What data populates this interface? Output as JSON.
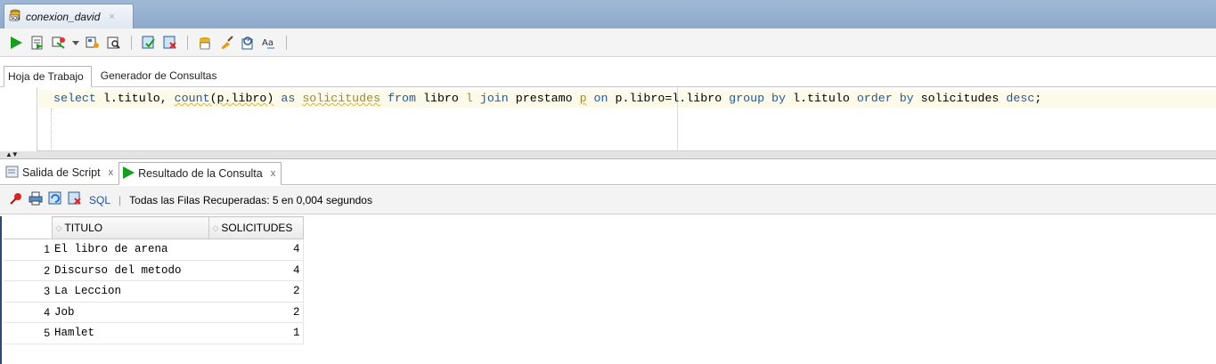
{
  "doc_tab": {
    "title": "conexion_david",
    "close": "×"
  },
  "toolbar": {
    "buttons": [
      "run-statement-icon",
      "run-script-icon",
      "autotrace-icon",
      "dropdown-chevron-icon",
      "explain-plan-icon",
      "sql-tuning-icon",
      "commit-icon",
      "rollback-icon",
      "sql-history-icon",
      "clear-icon",
      "sql-tuning-advisor-icon",
      "format-icon"
    ]
  },
  "worksheet_tabs": {
    "tab1": "Hoja de Trabajo",
    "tab2": "Generador de Consultas"
  },
  "editor": {
    "sql": [
      {
        "t": "select ",
        "c": "kw"
      },
      {
        "t": "l.titulo, ",
        "c": ""
      },
      {
        "t": "count",
        "c": "kw"
      },
      {
        "t": "(p.libro)",
        "c": ""
      },
      {
        "t": " as ",
        "c": "kw"
      },
      {
        "t": "solicitudes",
        "c": "al"
      },
      {
        "t": " from ",
        "c": "kw"
      },
      {
        "t": "libro ",
        "c": ""
      },
      {
        "t": "l",
        "c": "al"
      },
      {
        "t": " join ",
        "c": "kw"
      },
      {
        "t": "prestamo ",
        "c": ""
      },
      {
        "t": "p",
        "c": "al"
      },
      {
        "t": " on ",
        "c": "kw"
      },
      {
        "t": "p.libro=l.libro ",
        "c": ""
      },
      {
        "t": "group by ",
        "c": "kw"
      },
      {
        "t": "l.titulo ",
        "c": ""
      },
      {
        "t": "order by ",
        "c": "kw"
      },
      {
        "t": "solicitudes ",
        "c": ""
      },
      {
        "t": "desc",
        "c": "kw"
      },
      {
        "t": ";",
        "c": ""
      }
    ]
  },
  "result_tabs": {
    "script_output": "Salida de Script",
    "query_result": "Resultado de la Consulta",
    "close": "x"
  },
  "result_toolbar": {
    "sql_link": "SQL",
    "status": "Todas las Filas Recuperadas: 5 en 0,004 segundos"
  },
  "grid": {
    "columns": [
      "TITULO",
      "SOLICITUDES"
    ],
    "rows": [
      {
        "n": "1",
        "titulo": "El libro de arena",
        "solicitudes": "4"
      },
      {
        "n": "2",
        "titulo": "Discurso del metodo",
        "solicitudes": "4"
      },
      {
        "n": "3",
        "titulo": "La Leccion",
        "solicitudes": "2"
      },
      {
        "n": "4",
        "titulo": "Job",
        "solicitudes": "2"
      },
      {
        "n": "5",
        "titulo": "Hamlet",
        "solicitudes": "1"
      }
    ]
  },
  "colors": {
    "tabbar": "#9fb8d6",
    "keyword": "#1c5aa6",
    "alias": "#a08a2a",
    "run_green": "#1a9e22"
  }
}
